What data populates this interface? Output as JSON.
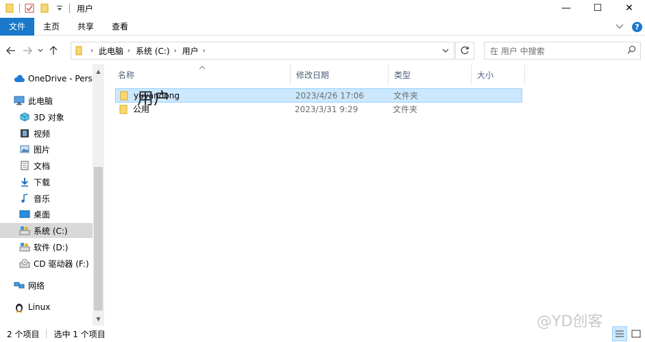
{
  "window": {
    "title": "用户",
    "controls": {
      "minimize": "—",
      "maximize": "☐",
      "close": "✕"
    }
  },
  "ribbon": {
    "tabs": [
      "文件",
      "主页",
      "共享",
      "查看"
    ],
    "expand_icon": "chevron-down-icon",
    "help_label": "?"
  },
  "address": {
    "crumbs": [
      "此电脑",
      "系统 (C:)",
      "用户"
    ],
    "search_placeholder": "在 用户 中搜索"
  },
  "nav": {
    "items": [
      {
        "label": "OneDrive - Personal",
        "icon": "cloud-icon",
        "indent": 0
      },
      {
        "label": "此电脑",
        "icon": "computer-icon",
        "indent": 0
      },
      {
        "label": "3D 对象",
        "icon": "cube-icon",
        "indent": 1
      },
      {
        "label": "视频",
        "icon": "film-icon",
        "indent": 1
      },
      {
        "label": "图片",
        "icon": "picture-icon",
        "indent": 1
      },
      {
        "label": "文档",
        "icon": "document-icon",
        "indent": 1
      },
      {
        "label": "下载",
        "icon": "download-icon",
        "indent": 1
      },
      {
        "label": "音乐",
        "icon": "music-icon",
        "indent": 1
      },
      {
        "label": "桌面",
        "icon": "desktop-icon",
        "indent": 1
      },
      {
        "label": "系统 (C:)",
        "icon": "drive-icon",
        "indent": 1,
        "selected": true
      },
      {
        "label": "软件 (D:)",
        "icon": "drive-icon",
        "indent": 1
      },
      {
        "label": "CD 驱动器 (F:)",
        "icon": "cd-drive-icon",
        "indent": 1
      },
      {
        "label": "网络",
        "icon": "network-icon",
        "indent": 0
      },
      {
        "label": "Linux",
        "icon": "linux-icon",
        "indent": 0
      }
    ]
  },
  "columns": [
    "名称",
    "修改日期",
    "类型",
    "大小"
  ],
  "files": [
    {
      "name": "yuyandong",
      "date": "2023/4/26 17:06",
      "type": "文件夹",
      "selected": true
    },
    {
      "name": "公用",
      "date": "2023/3/31 9:29",
      "type": "文件夹",
      "selected": false
    }
  ],
  "overlay_text": "用户",
  "status": {
    "count": "2 个项目",
    "selected": "选中 1 个项目"
  },
  "watermark": "@YD创客",
  "colors": {
    "accent": "#1979ca",
    "selection": "#cce8ff",
    "selection_border": "#99d1ff",
    "folder": "#f8d775"
  }
}
